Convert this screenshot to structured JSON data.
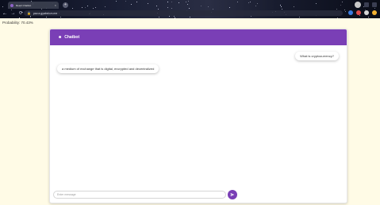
{
  "browser": {
    "tab_title": "React Chatbot",
    "tab_close": "×",
    "new_tab": "+",
    "url": "pav.a.gyabsh.m.me",
    "nav": {
      "back": "←",
      "forward": "→",
      "reload": "⟳",
      "home": "⌂"
    },
    "lock": "🔒"
  },
  "page": {
    "probability_text": "Probability: 70.43%"
  },
  "chat": {
    "header_icon": "☻",
    "title": "Chatbot",
    "accent": "#7a3fb6",
    "messages": [
      {
        "role": "user",
        "text": "What is cryptocurrency?"
      },
      {
        "role": "bot",
        "text": "a medium of exchange that is digital, encrypted and decentralized"
      }
    ],
    "input_placeholder": "Enter message",
    "send_icon": "send-icon"
  }
}
